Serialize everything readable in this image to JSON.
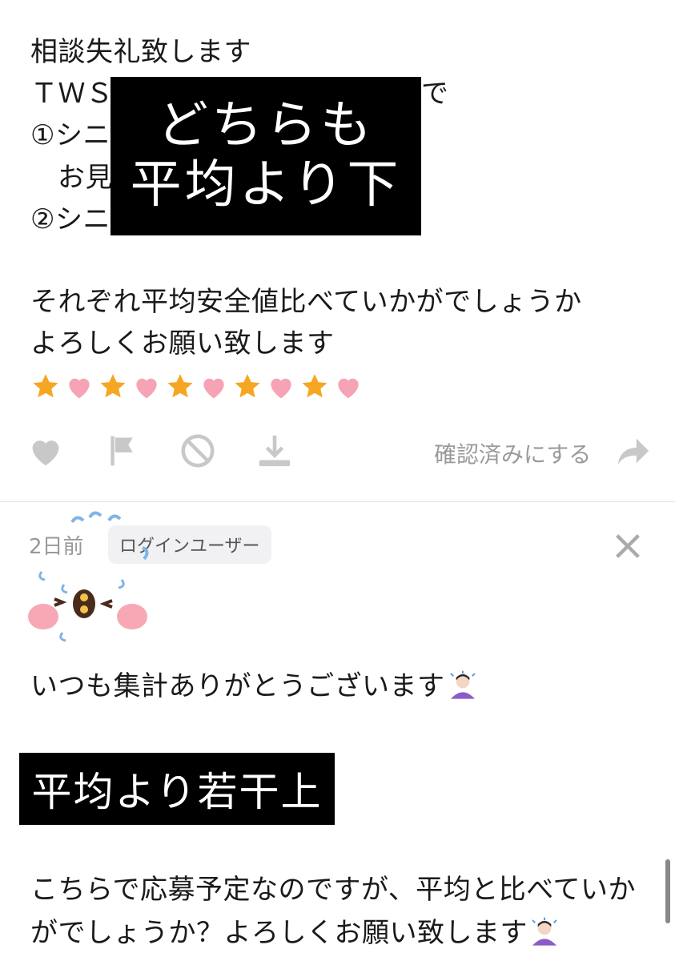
{
  "post": {
    "lines": [
      "相談失礼致します",
      "ＴＷＳ",
      "で",
      "①シニ",
      "お見",
      "②シニ",
      ")"
    ],
    "censor_text_1": "どちらも",
    "censor_text_2": "平均より下",
    "question": "それぞれ平均安全値比べていかがでしょうか",
    "request": "よろしくお願い致します",
    "decor": [
      "star",
      "heart",
      "star",
      "heart",
      "star",
      "heart",
      "star",
      "heart",
      "star",
      "heart"
    ]
  },
  "actions": {
    "confirm_label": "確認済みにする",
    "icons": [
      "heart-icon",
      "flag-icon",
      "block-icon",
      "download-icon",
      "share-arrow-icon"
    ]
  },
  "comment": {
    "time": "2日前",
    "badge": "ログインユーザー",
    "close_icon": "close-icon",
    "thanks": "いつも集計ありがとうございます",
    "censor_text": "平均より若干上",
    "body_line1": "こちらで応募予定なのですが、平均と比べていか",
    "body_line2": "がでしょうか？よろしくお願い致します"
  },
  "colors": {
    "star": "#f5a623",
    "heart": "#f5a3b5",
    "icon_gray": "#c8c8c8",
    "cheek": "#f7a8b4",
    "drop": "#7fb4e6",
    "bean": "#4a2a1a"
  }
}
